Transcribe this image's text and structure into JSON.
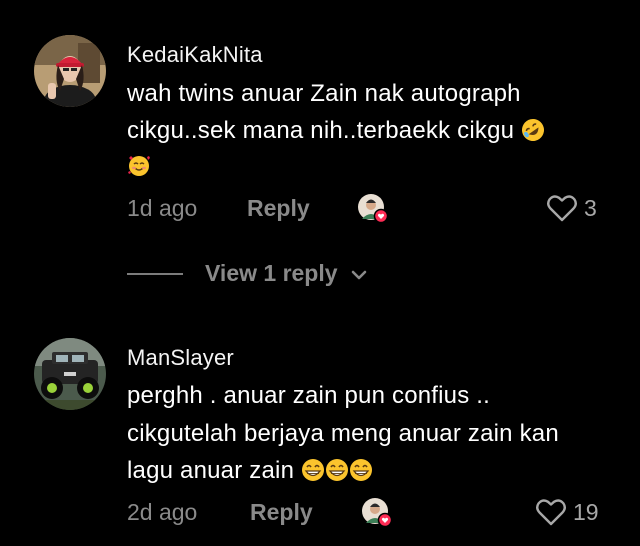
{
  "comments": [
    {
      "username": "KedaiKakNita",
      "lines": [
        "wah twins anuar Zain nak autograph",
        "cikgu..sek mana nih..terbaekk cikgu"
      ],
      "line_emojis": [
        "rolling-on-floor-laughing-emoji",
        "smiling-face-with-hearts-emoji"
      ],
      "time": "1d ago",
      "reply_label": "Reply",
      "likes": "3",
      "avatar_icon": "woman-red-cap-avatar"
    },
    {
      "username": "ManSlayer",
      "lines": [
        "perghh . anuar zain pun confius ..",
        "cikgutelah berjaya meng anuar zain kan",
        "lagu anuar zain"
      ],
      "line_emojis": [
        "beaming-face-emoji",
        "beaming-face-emoji",
        "beaming-face-emoji"
      ],
      "time": "2d ago",
      "reply_label": "Reply",
      "likes": "19",
      "avatar_icon": "off-road-truck-avatar"
    }
  ],
  "view_replies": {
    "label": "View 1 reply"
  },
  "colors": {
    "background": "#000000",
    "text": "#ffffff",
    "muted": "#8a8a8a",
    "creator_heart": "#fe2c55"
  }
}
